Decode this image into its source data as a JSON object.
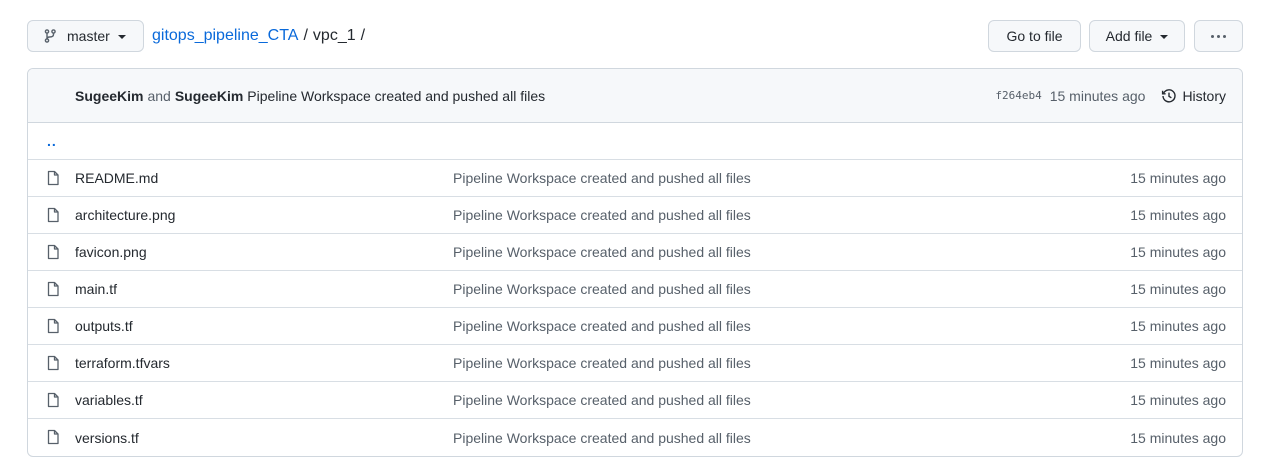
{
  "topbar": {
    "branch_label": "master",
    "branch_icon": "git-branch-icon",
    "repo_name": "gitops_pipeline_CTA",
    "separator": "/",
    "folder": "vpc_1",
    "trailing_separator": "/",
    "go_to_file_label": "Go to file",
    "add_file_label": "Add file",
    "more_icon": "kebab-horizontal-icon"
  },
  "commit": {
    "author1": "SugeeKim",
    "and_text": "and",
    "author2": "SugeeKim",
    "message": "Pipeline Workspace created and pushed all files",
    "sha": "f264eb4",
    "time_ago": "15 minutes ago",
    "history_label": "History",
    "history_icon": "history-clock-icon"
  },
  "parent_link": "..",
  "files": [
    {
      "name": "README.md",
      "message": "Pipeline Workspace created and pushed all files",
      "age": "15 minutes ago",
      "icon": "file-icon"
    },
    {
      "name": "architecture.png",
      "message": "Pipeline Workspace created and pushed all files",
      "age": "15 minutes ago",
      "icon": "file-icon"
    },
    {
      "name": "favicon.png",
      "message": "Pipeline Workspace created and pushed all files",
      "age": "15 minutes ago",
      "icon": "file-icon"
    },
    {
      "name": "main.tf",
      "message": "Pipeline Workspace created and pushed all files",
      "age": "15 minutes ago",
      "icon": "file-icon"
    },
    {
      "name": "outputs.tf",
      "message": "Pipeline Workspace created and pushed all files",
      "age": "15 minutes ago",
      "icon": "file-icon"
    },
    {
      "name": "terraform.tfvars",
      "message": "Pipeline Workspace created and pushed all files",
      "age": "15 minutes ago",
      "icon": "file-icon"
    },
    {
      "name": "variables.tf",
      "message": "Pipeline Workspace created and pushed all files",
      "age": "15 minutes ago",
      "icon": "file-icon"
    },
    {
      "name": "versions.tf",
      "message": "Pipeline Workspace created and pushed all files",
      "age": "15 minutes ago",
      "icon": "file-icon"
    }
  ],
  "colors": {
    "link": "#0969da",
    "text": "#24292f",
    "muted": "#57606a",
    "border": "#d0d7de",
    "header_bg": "#f6f8fa"
  }
}
